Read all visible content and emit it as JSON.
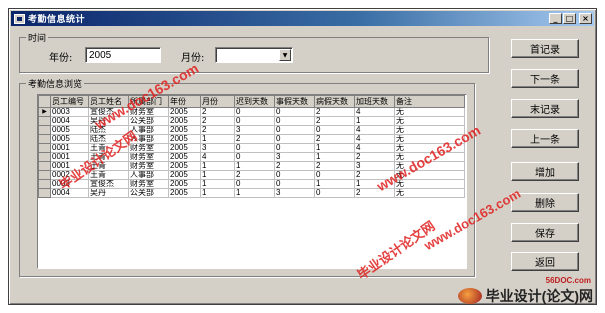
{
  "window": {
    "title": "考勤信息统计",
    "buttons": {
      "minimize": "_",
      "maximize": "□",
      "close": "×"
    }
  },
  "time_group": {
    "label": "时间",
    "year_label": "年份:",
    "year_value": "2005",
    "month_label": "月份:",
    "month_value": ""
  },
  "browse_group": {
    "label": "考勤信息浏览"
  },
  "grid": {
    "columns": [
      "员工编号",
      "员工姓名",
      "所属部门",
      "年份",
      "月份",
      "迟到天数",
      "事假天数",
      "病假天数",
      "加班天数",
      "备注"
    ],
    "rows": [
      [
        "0003",
        "宣俊杰",
        "财务室",
        "2005",
        "2",
        "0",
        "0",
        "2",
        "4",
        "无"
      ],
      [
        "0004",
        "吴丹",
        "公关部",
        "2005",
        "2",
        "0",
        "0",
        "2",
        "1",
        "无"
      ],
      [
        "0005",
        "陆杰",
        "人事部",
        "2005",
        "2",
        "3",
        "0",
        "0",
        "4",
        "无"
      ],
      [
        "0005",
        "陆杰",
        "人事部",
        "2005",
        "1",
        "2",
        "0",
        "2",
        "4",
        "无"
      ],
      [
        "0001",
        "王青",
        "财务室",
        "2005",
        "3",
        "0",
        "0",
        "1",
        "4",
        "无"
      ],
      [
        "0001",
        "王青",
        "财务室",
        "2005",
        "4",
        "0",
        "3",
        "1",
        "2",
        "无"
      ],
      [
        "0001",
        "王青",
        "财务室",
        "2005",
        "1",
        "1",
        "2",
        "2",
        "3",
        "无"
      ],
      [
        "0002",
        "王青",
        "人事部",
        "2005",
        "1",
        "2",
        "0",
        "0",
        "2",
        "无"
      ],
      [
        "0003",
        "宣俊杰",
        "财务室",
        "2005",
        "1",
        "0",
        "0",
        "1",
        "1",
        "无"
      ],
      [
        "0004",
        "吴丹",
        "公关部",
        "2005",
        "1",
        "1",
        "3",
        "0",
        "2",
        "无"
      ]
    ],
    "selected_marker": "▶"
  },
  "actions": {
    "first": "首记录",
    "next": "下一条",
    "last": "末记录",
    "prev": "上一条",
    "add": "增加",
    "delete": "删除",
    "save": "保存",
    "back": "返回"
  },
  "watermarks": {
    "url": "www.doc163.com",
    "site": "毕业设计论文网",
    "brand_small": "56DOC.com",
    "brand": "毕业设计(论文)网"
  }
}
